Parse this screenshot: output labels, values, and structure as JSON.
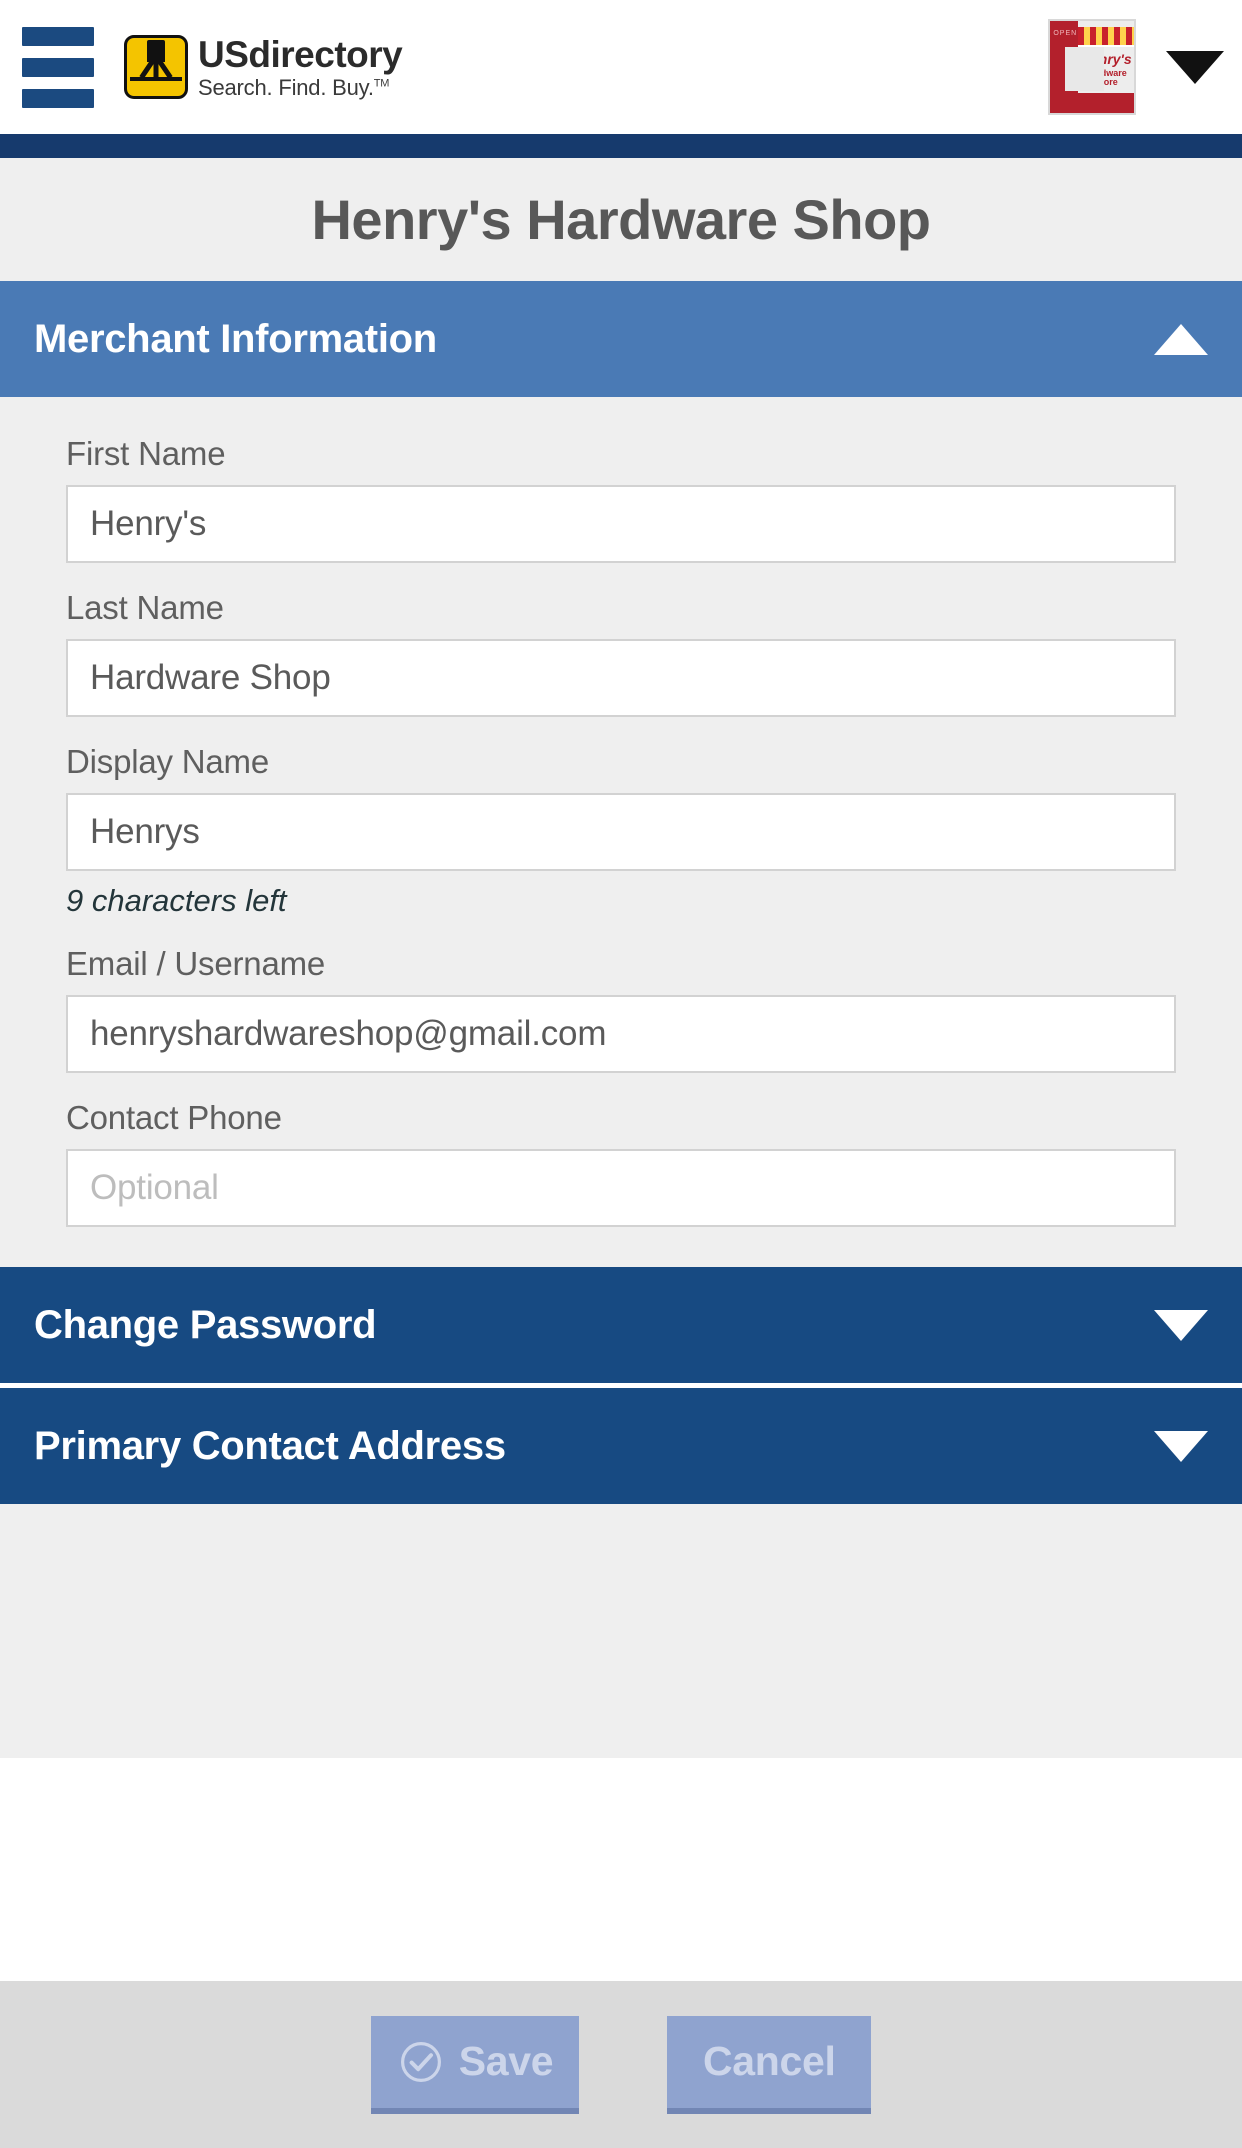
{
  "appbar": {
    "menu_icon": "hamburger-menu-icon",
    "brand_name": "USdirectory",
    "brand_tagline": "Search. Find. Buy.",
    "brand_tm": "TM",
    "store_icon": "storefront-icon",
    "store_sign_line1": "Henry's",
    "store_sign_line2": "Hardware Store",
    "store_open_text": "OPEN",
    "account_caret_icon": "chevron-down-icon"
  },
  "page": {
    "title": "Henry's Hardware Shop"
  },
  "sections": [
    {
      "id": "merchant-information",
      "label": "Merchant Information",
      "expanded": true,
      "caret_icon": "chevron-up-icon"
    },
    {
      "id": "change-password",
      "label": "Change Password",
      "expanded": false,
      "caret_icon": "chevron-down-icon"
    },
    {
      "id": "primary-contact-address",
      "label": "Primary Contact Address",
      "expanded": false,
      "caret_icon": "chevron-down-icon"
    }
  ],
  "form": {
    "first_name": {
      "label": "First Name",
      "value": "Henry's",
      "placeholder": ""
    },
    "last_name": {
      "label": "Last Name",
      "value": "Hardware Shop",
      "placeholder": ""
    },
    "display_name": {
      "label": "Display Name",
      "value": "Henrys",
      "placeholder": "",
      "hint": "9 characters left"
    },
    "email": {
      "label": "Email / Username",
      "value": "henryshardwareshop@gmail.com",
      "placeholder": ""
    },
    "contact_phone": {
      "label": "Contact Phone",
      "value": "",
      "placeholder": "Optional"
    }
  },
  "footer": {
    "save_label": "Save",
    "save_icon": "check-circle-icon",
    "cancel_label": "Cancel"
  },
  "colors": {
    "navy_strip": "#163a6d",
    "section_open": "#4a7ab5",
    "section_closed": "#174a82",
    "page_bg": "#efefef",
    "footer_bg": "#dadada",
    "button": "#8fa3cf",
    "button_text": "#ccd5ea",
    "brand_yellow": "#f4c400",
    "store_red": "#b3202c"
  }
}
